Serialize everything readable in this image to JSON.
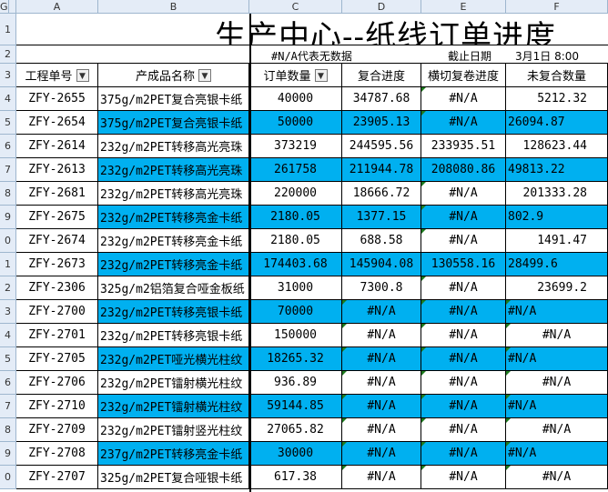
{
  "columns": [
    "A",
    "B",
    "C",
    "D",
    "E",
    "F",
    "G"
  ],
  "title": "生产中心--纸线订单进度",
  "note": "#N/A代表无数据",
  "cutoff_label": "截止日期",
  "cutoff_value": "3月1日 8:00",
  "headers": [
    "工程单号",
    "产成品名称",
    "订单数量",
    "复合进度",
    "横切复卷进度",
    "未复合数量"
  ],
  "row_numbers": [
    "1",
    "2",
    "3",
    "4",
    "5",
    "6",
    "7",
    "8",
    "9",
    "0",
    "1",
    "2",
    "3",
    "4",
    "5",
    "6",
    "7",
    "8",
    "9",
    "0"
  ],
  "rows": [
    {
      "id": "ZFY-2655",
      "name": "375g/m2PET复合亮银卡纸",
      "qty": "40000",
      "comp": "34787.68",
      "cut": "#N/A",
      "rem": "5212.32",
      "blue": false
    },
    {
      "id": "ZFY-2654",
      "name": "375g/m2PET复合亮银卡纸",
      "qty": "50000",
      "comp": "23905.13",
      "cut": "#N/A",
      "rem": "26094.87",
      "blue": true
    },
    {
      "id": "ZFY-2614",
      "name": "232g/m2PET转移高光亮珠",
      "qty": "373219",
      "comp": "244595.56",
      "cut": "233935.51",
      "rem": "128623.44",
      "blue": false
    },
    {
      "id": "ZFY-2613",
      "name": "232g/m2PET转移高光亮珠",
      "qty": "261758",
      "comp": "211944.78",
      "cut": "208080.86",
      "rem": "49813.22",
      "blue": true
    },
    {
      "id": "ZFY-2681",
      "name": "232g/m2PET转移高光亮珠",
      "qty": "220000",
      "comp": "18666.72",
      "cut": "#N/A",
      "rem": "201333.28",
      "blue": false
    },
    {
      "id": "ZFY-2675",
      "name": "232g/m2PET转移亮金卡纸",
      "qty": "2180.05",
      "comp": "1377.15",
      "cut": "#N/A",
      "rem": "802.9",
      "blue": true
    },
    {
      "id": "ZFY-2674",
      "name": "232g/m2PET转移亮金卡纸",
      "qty": "2180.05",
      "comp": "688.58",
      "cut": "#N/A",
      "rem": "1491.47",
      "blue": false
    },
    {
      "id": "ZFY-2673",
      "name": "232g/m2PET转移亮金卡纸",
      "qty": "174403.68",
      "comp": "145904.08",
      "cut": "130558.16",
      "rem": "28499.6",
      "blue": true
    },
    {
      "id": "ZFY-2306",
      "name": "325g/m2铝箔复合哑金板纸",
      "qty": "31000",
      "comp": "7300.8",
      "cut": "#N/A",
      "rem": "23699.2",
      "blue": false
    },
    {
      "id": "ZFY-2700",
      "name": "232g/m2PET转移亮银卡纸",
      "qty": "70000",
      "comp": "#N/A",
      "cut": "#N/A",
      "rem": "#N/A",
      "blue": true
    },
    {
      "id": "ZFY-2701",
      "name": "232g/m2PET转移亮银卡纸",
      "qty": "150000",
      "comp": "#N/A",
      "cut": "#N/A",
      "rem": "#N/A",
      "blue": false
    },
    {
      "id": "ZFY-2705",
      "name": "232g/m2PET哑光横光柱纹",
      "qty": "18265.32",
      "comp": "#N/A",
      "cut": "#N/A",
      "rem": "#N/A",
      "blue": true
    },
    {
      "id": "ZFY-2706",
      "name": "232g/m2PET镭射横光柱纹",
      "qty": "936.89",
      "comp": "#N/A",
      "cut": "#N/A",
      "rem": "#N/A",
      "blue": false
    },
    {
      "id": "ZFY-2710",
      "name": "232g/m2PET镭射横光柱纹",
      "qty": "59144.85",
      "comp": "#N/A",
      "cut": "#N/A",
      "rem": "#N/A",
      "blue": true
    },
    {
      "id": "ZFY-2709",
      "name": "232g/m2PET镭射竖光柱纹",
      "qty": "27065.82",
      "comp": "#N/A",
      "cut": "#N/A",
      "rem": "#N/A",
      "blue": false
    },
    {
      "id": "ZFY-2708",
      "name": "237g/m2PET转移亮金卡纸",
      "qty": "30000",
      "comp": "#N/A",
      "cut": "#N/A",
      "rem": "#N/A",
      "blue": true
    },
    {
      "id": "ZFY-2707",
      "name": "325g/m2PET复合哑银卡纸",
      "qty": "617.38",
      "comp": "#N/A",
      "cut": "#N/A",
      "rem": "#N/A",
      "blue": false
    }
  ],
  "colors": {
    "highlight": "#00b0f0",
    "header_bg": "#e4ecf7",
    "error_flag": "#1e7b1e"
  },
  "icons": {
    "filter": "dropdown-arrow-icon"
  }
}
